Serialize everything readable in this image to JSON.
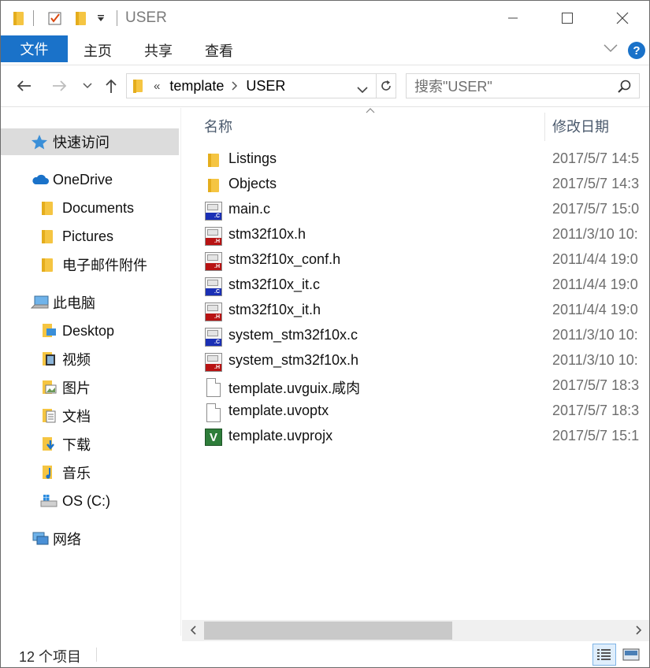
{
  "titlebar": {
    "title": "USER",
    "minimize_icon": "minimize-icon",
    "maximize_icon": "maximize-icon",
    "close_icon": "close-icon"
  },
  "ribbon": {
    "file_tab": "文件",
    "tabs": [
      "主页",
      "共享",
      "查看"
    ],
    "help": "?"
  },
  "nav": {
    "breadcrumb_prefix": "«",
    "breadcrumb": [
      "template",
      "USER"
    ],
    "search_placeholder": "搜索\"USER\""
  },
  "sidebar": {
    "quick_access": "快速访问",
    "onedrive": "OneDrive",
    "onedrive_items": [
      "Documents",
      "Pictures",
      "电子邮件附件"
    ],
    "this_pc": "此电脑",
    "pc_items": [
      "Desktop",
      "视频",
      "图片",
      "文档",
      "下载",
      "音乐",
      "OS (C:)"
    ],
    "network": "网络"
  },
  "content": {
    "col_name": "名称",
    "col_date": "修改日期",
    "files": [
      {
        "name": "Listings",
        "date": "2017/5/7 14:5",
        "type": "folder"
      },
      {
        "name": "Objects",
        "date": "2017/5/7 14:3",
        "type": "folder"
      },
      {
        "name": "main.c",
        "date": "2017/5/7 15:0",
        "type": "c"
      },
      {
        "name": "stm32f10x.h",
        "date": "2011/3/10 10:",
        "type": "h"
      },
      {
        "name": "stm32f10x_conf.h",
        "date": "2011/4/4 19:0",
        "type": "h"
      },
      {
        "name": "stm32f10x_it.c",
        "date": "2011/4/4 19:0",
        "type": "c"
      },
      {
        "name": "stm32f10x_it.h",
        "date": "2011/4/4 19:0",
        "type": "h"
      },
      {
        "name": "system_stm32f10x.c",
        "date": "2011/3/10 10:",
        "type": "c"
      },
      {
        "name": "system_stm32f10x.h",
        "date": "2011/3/10 10:",
        "type": "h"
      },
      {
        "name": "template.uvguix.咸肉",
        "date": "2017/5/7 18:3",
        "type": "doc"
      },
      {
        "name": "template.uvoptx",
        "date": "2017/5/7 18:3",
        "type": "doc"
      },
      {
        "name": "template.uvprojx",
        "date": "2017/5/7 15:1",
        "type": "uv"
      }
    ]
  },
  "status": {
    "item_count": "12 个项目"
  },
  "colors": {
    "accent": "#1a72c9",
    "folder": "#f5c542",
    "selected": "#dcdcdc"
  }
}
